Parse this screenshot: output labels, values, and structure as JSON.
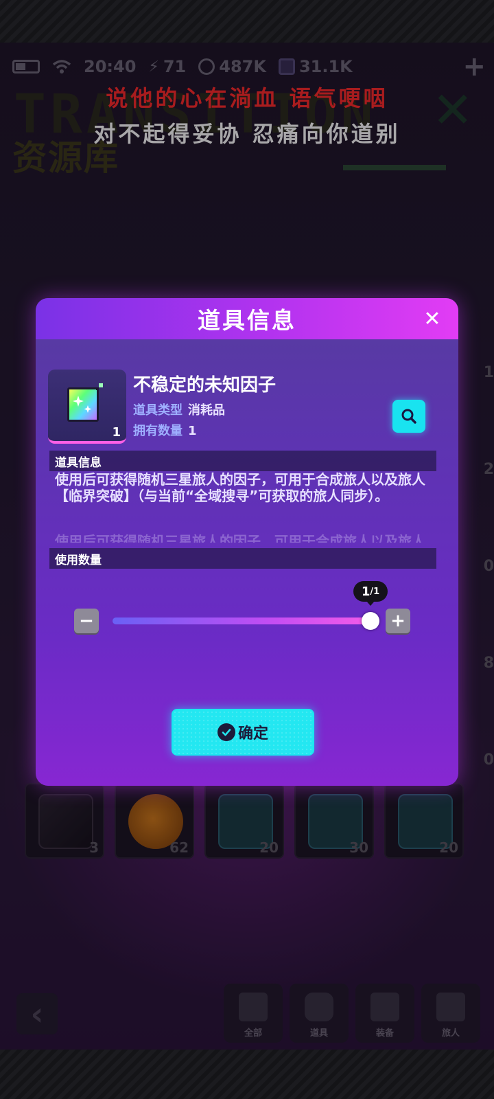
{
  "status_bar": {
    "time": "20:40",
    "stamina": "71",
    "coins": "487K",
    "gems": "31.1K"
  },
  "header": {
    "title": "资源库"
  },
  "lyrics": {
    "line1": "说他的心在淌血  语气哽咽",
    "line2": "对不起得妥协  忍痛向你道别"
  },
  "background_grid": {
    "side_counts": [
      "1",
      "2",
      "0",
      "8",
      "0"
    ],
    "bottom_row_counts": [
      "3",
      "62",
      "20",
      "30",
      "20"
    ]
  },
  "bottom_nav": {
    "items": [
      {
        "label": "全部"
      },
      {
        "label": "道具"
      },
      {
        "label": "装备"
      },
      {
        "label": "旅人"
      }
    ]
  },
  "dialog": {
    "title": "道具信息",
    "item": {
      "name": "不稳定的未知因子",
      "count_badge": "1",
      "type_key": "道具类型",
      "type_value": "消耗品",
      "owned_key": "拥有数量",
      "owned_value": "1"
    },
    "info_section_title": "道具信息",
    "description": "使用后可获得随机三星旅人的因子，可用于合成旅人以及旅人【临界突破】（与当前“全域搜寻”可获取的旅人同步）。",
    "quantity_section_title": "使用数量",
    "slider": {
      "value": 1,
      "max": 1,
      "tooltip_num": "1",
      "tooltip_den": "/1"
    },
    "confirm_label": "确定"
  },
  "colors": {
    "dialog_header_start": "#7a32e6",
    "dialog_header_end": "#e23cf4",
    "accent_cyan": "#23e7f1",
    "lyric_red": "#ff2a2a"
  }
}
